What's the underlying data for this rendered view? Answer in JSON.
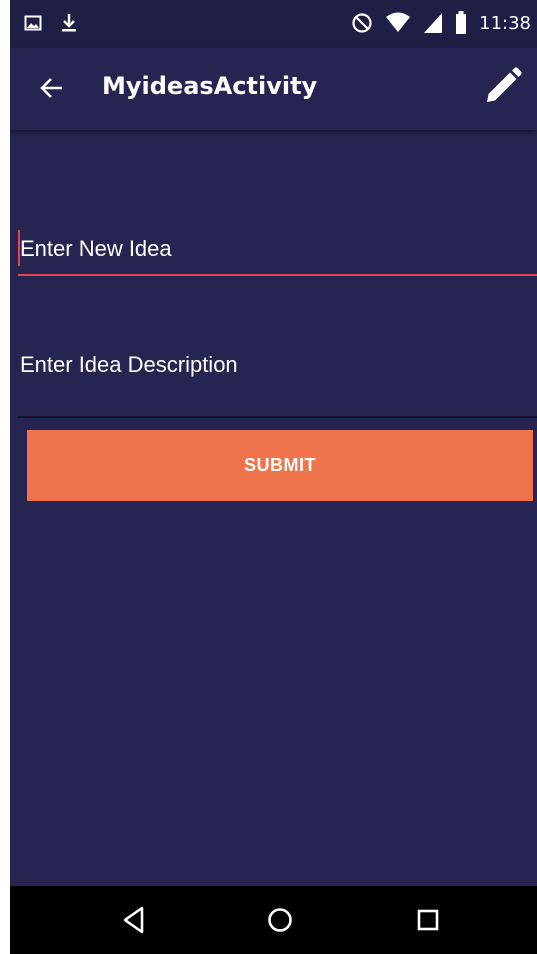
{
  "status_bar": {
    "time": "11:38",
    "icons": [
      "image-icon",
      "download-icon",
      "do-not-disturb-icon",
      "wifi-icon",
      "signal-icon",
      "battery-icon"
    ]
  },
  "app_bar": {
    "title": "MyideasActivity",
    "back_icon": "arrow-back-icon",
    "action_icon": "pencil-icon"
  },
  "form": {
    "idea_field_placeholder": "Enter New Idea",
    "description_field_placeholder": "Enter Idea Description",
    "submit_label": "SUBMIT"
  },
  "nav_bar": {
    "icons": [
      "back-triangle-icon",
      "home-circle-icon",
      "recents-square-icon"
    ]
  },
  "colors": {
    "background": "#262551",
    "accent": "#f0744b",
    "focus_underline": "#e84350"
  }
}
